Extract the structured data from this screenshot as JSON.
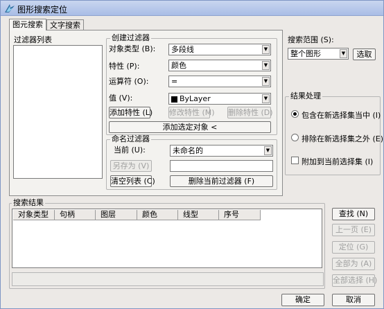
{
  "window": {
    "title": "图形搜索定位",
    "icon": "app-icon"
  },
  "tabs": [
    {
      "label": "图元搜索",
      "active": true
    },
    {
      "label": "文字搜索",
      "active": false
    }
  ],
  "filter_list": {
    "label": "过滤器列表"
  },
  "create_filter": {
    "legend": "创建过滤器",
    "object_type_label": "对象类型 (B):",
    "object_type_value": "多段线",
    "property_label": "特性 (P):",
    "property_value": "颜色",
    "operator_label": "运算符 (O):",
    "operator_value": "=",
    "value_label": "值 (V):",
    "value_value": "ByLayer",
    "value_swatch_color": "#000000",
    "add_property_button": "添加特性 (L)",
    "modify_property_button": "修改特性 (M)",
    "delete_property_button": "删除特性 (D)",
    "add_selected_button": "添加选定对象 <"
  },
  "named_filter": {
    "legend": "命名过滤器",
    "current_label": "当前 (U):",
    "current_value": "未命名的",
    "save_as_button": "另存为 (V)",
    "clear_list_button": "清空列表 (C)",
    "delete_current_button": "删除当前过滤器 (F)"
  },
  "search_range": {
    "label": "搜索范围 (S):",
    "value": "整个图形",
    "select_button": "选取"
  },
  "result_handling": {
    "legend": "结果处理",
    "include_label": "包含在新选择集当中 (I)",
    "include_checked": true,
    "exclude_label": "排除在新选择集之外 (E)",
    "exclude_checked": false,
    "append_label": "附加到当前选择集 (I)",
    "append_checked": false
  },
  "search_results": {
    "legend": "搜索结果",
    "columns": [
      "对象类型",
      "句柄",
      "图层",
      "颜色",
      "线型",
      "序号"
    ]
  },
  "side_buttons": {
    "find": "查找 (N)",
    "prev_page": "上一页 (E)",
    "locate": "定位 (G)",
    "zoom_all": "全部为 (A)",
    "select_all": "全部选择 (H)"
  },
  "footer": {
    "ok": "确定",
    "cancel": "取消"
  }
}
